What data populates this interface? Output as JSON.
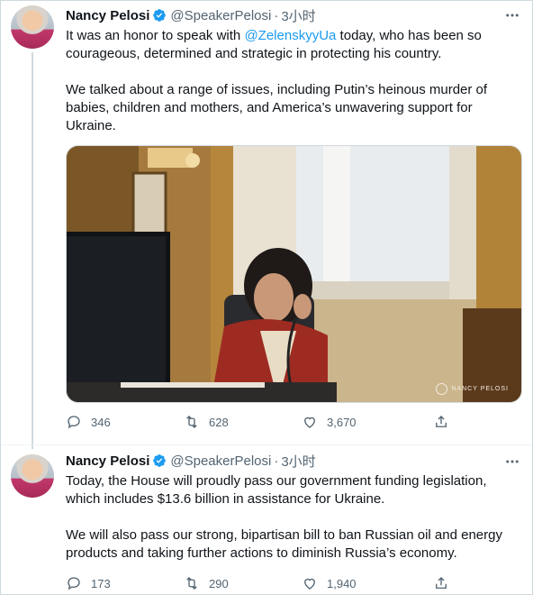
{
  "tweets": [
    {
      "author_name": "Nancy Pelosi",
      "handle": "@SpeakerPelosi",
      "separator": "·",
      "time": "3小时",
      "text_p1_before": "It was an honor to speak with ",
      "text_p1_mention": "@ZelenskyyUa",
      "text_p1_after": " today, who has been so courageous, determined and strategic in protecting his country.",
      "text_p2": "We talked about a range of issues, including Putin’s heinous murder of babies, children and mothers, and America’s unwavering support for Ukraine.",
      "photo_credit": "NANCY PELOSI",
      "replies": "346",
      "retweets": "628",
      "likes": "3,670"
    },
    {
      "author_name": "Nancy Pelosi",
      "handle": "@SpeakerPelosi",
      "separator": "·",
      "time": "3小时",
      "text_p1": "Today, the House will proudly pass our government funding legislation, which includes $13.6 billion in assistance for Ukraine.",
      "text_p2": "We will also pass our strong, bipartisan bill to ban Russian oil and energy products and taking further actions to diminish Russia’s economy.",
      "replies": "173",
      "retweets": "290",
      "likes": "1,940"
    }
  ],
  "colors": {
    "accent": "#1d9bf0",
    "text": "#0f1419",
    "secondary": "#536471",
    "border": "#cfd9de"
  },
  "icons": [
    "more-icon",
    "verified-icon",
    "reply-icon",
    "retweet-icon",
    "like-icon",
    "share-icon"
  ]
}
